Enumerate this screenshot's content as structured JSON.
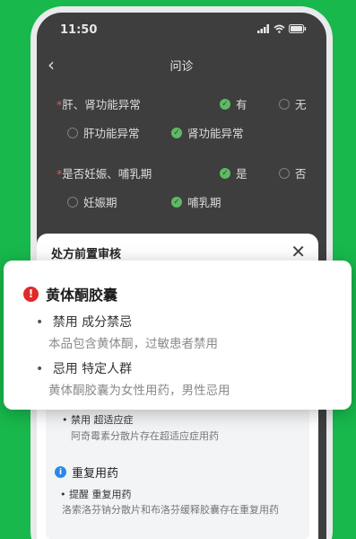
{
  "status": {
    "time": "11:50"
  },
  "nav": {
    "title": "问诊",
    "back_icon": "chevron-left-icon"
  },
  "questions": [
    {
      "label": "*肝、肾功能异常",
      "yes": "有",
      "no": "无",
      "selected": "yes",
      "options": [
        {
          "label": "肝功能异常",
          "checked": false
        },
        {
          "label": "肾功能异常",
          "checked": true
        }
      ]
    },
    {
      "label": "*是否妊娠、哺乳期",
      "yes": "是",
      "no": "否",
      "selected": "yes",
      "options": [
        {
          "label": "妊娠期",
          "checked": false
        },
        {
          "label": "哺乳期",
          "checked": true
        }
      ]
    }
  ],
  "sheet": {
    "title": "处方前置审核",
    "close_icon": "close-icon",
    "cards": [
      {
        "line": "禁用  超适应症",
        "desc": "阿奇霉素分散片存在超适应症用药"
      },
      {
        "head": "重复用药",
        "line": "提醒  重复用药",
        "desc": "洛索洛芬钠分散片和布洛芬缓释胶囊存在重复用药"
      }
    ]
  },
  "popup": {
    "drug": "黄体酮胶囊",
    "items": [
      {
        "title": "禁用  成分禁忌",
        "desc": "本品包含黄体酮，过敏患者禁用"
      },
      {
        "title": "忌用  特定人群",
        "desc": "黄体酮胶囊为女性用药，男性忌用"
      }
    ]
  },
  "colors": {
    "background": "#18b84c",
    "warning": "#e02a2a",
    "info": "#2a88e8",
    "check": "#5dbb63"
  }
}
